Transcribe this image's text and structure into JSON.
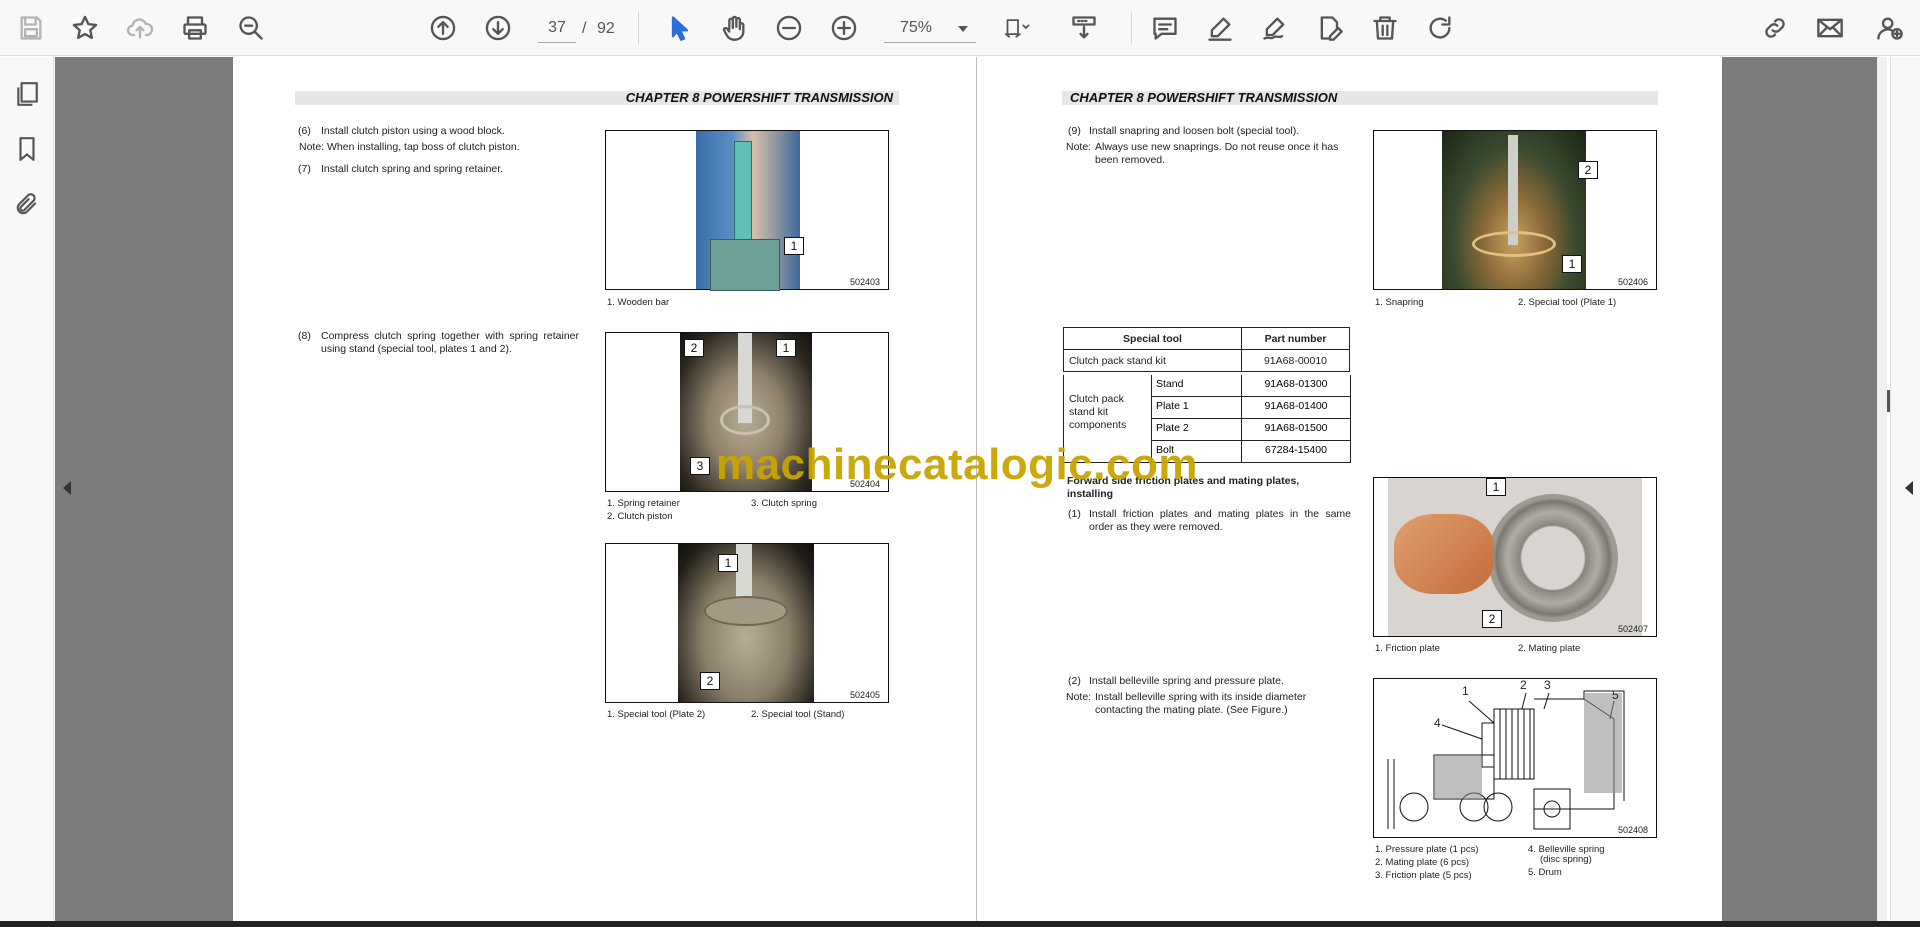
{
  "toolbar": {
    "current_page": "37",
    "page_separator": "/",
    "total_pages": "92",
    "zoom": "75%"
  },
  "left_page": {
    "chapter_header": "CHAPTER 8 POWERSHIFT TRANSMISSION",
    "step6_num": "(6)",
    "step6_text": "Install clutch piston using a wood block.",
    "step6_note": "Note: When installing, tap boss of clutch piston.",
    "step7_num": "(7)",
    "step7_text": "Install clutch spring and spring retainer.",
    "fig1": {
      "code": "502403",
      "callout1": "1",
      "caption1": "1. Wooden bar"
    },
    "step8_num": "(8)",
    "step8_text": "Compress clutch spring together with spring retainer using stand (special tool, plates 1 and 2).",
    "fig2": {
      "code": "502404",
      "callout1": "1",
      "callout2": "2",
      "callout3": "3",
      "caption1": "1. Spring retainer",
      "caption2": "2. Clutch piston",
      "caption3": "3. Clutch spring"
    },
    "fig3": {
      "code": "502405",
      "callout1": "1",
      "callout2": "2",
      "caption1": "1. Special tool (Plate 2)",
      "caption2": "2. Special tool (Stand)"
    }
  },
  "right_page": {
    "chapter_header": "CHAPTER 8 POWERSHIFT TRANSMISSION",
    "step9_num": "(9)",
    "step9_text": "Install snapring and loosen bolt (special tool).",
    "step9_note_label": "Note:",
    "step9_note": "Always use new snaprings. Do not reuse once it has been removed.",
    "fig4": {
      "code": "502406",
      "callout1": "1",
      "callout2": "2",
      "caption1": "1. Snapring",
      "caption2": "2. Special tool (Plate 1)"
    },
    "table": {
      "header_tool": "Special tool",
      "header_part": "Part number",
      "row1_tool": "Clutch pack stand kit",
      "row1_part": "91A68-00010",
      "group_label": "Clutch pack stand kit components",
      "sub1_name": "Stand",
      "sub1_part": "91A68-01300",
      "sub2_name": "Plate 1",
      "sub2_part": "91A68-01400",
      "sub3_name": "Plate 2",
      "sub3_part": "91A68-01500",
      "sub4_name": "Bolt",
      "sub4_part": "67284-15400"
    },
    "section_title": "Forward side friction plates and mating plates, installing",
    "step1_num": "(1)",
    "step1_text": "Install friction plates and mating plates in the same order as they were removed.",
    "fig5": {
      "code": "502407",
      "callout1": "1",
      "callout2": "2",
      "caption1": "1. Friction plate",
      "caption2": "2. Mating plate"
    },
    "step2_num": "(2)",
    "step2_text": "Install belleville spring and pressure plate.",
    "step2_note_label": "Note:",
    "step2_note": "Install belleville spring with its inside diameter contacting the mating plate. (See Figure.)",
    "fig6": {
      "code": "502408",
      "label1": "1",
      "label2": "2",
      "label3": "3",
      "label4": "4",
      "label5": "5",
      "caption1": "1. Pressure plate (1 pcs)",
      "caption2": "2. Mating plate (6 pcs)",
      "caption3": "3. Friction plate (5 pcs)",
      "caption4": "4. Belleville spring",
      "caption4b": "(disc spring)",
      "caption5": "5. Drum"
    }
  },
  "watermark": "machinecatalogic.com",
  "icons": [
    "save-icon",
    "star-icon",
    "upload-icon",
    "print-icon",
    "zoom-search-icon",
    "prev-page-icon",
    "next-page-icon",
    "select-cursor-icon",
    "hand-icon",
    "zoom-out-icon",
    "zoom-in-icon",
    "fit-page-icon",
    "scroll-mode-icon",
    "comment-icon",
    "highlight-icon",
    "sign-icon",
    "edit-icon",
    "delete-icon",
    "rotate-icon",
    "share-link-icon",
    "mail-icon",
    "account-icon",
    "thumbnails-icon",
    "bookmark-icon",
    "attachment-icon"
  ],
  "colors": {
    "accent": "#2c6fdb",
    "watermark": "#c9a400",
    "gutter": "#7c7c7c"
  }
}
